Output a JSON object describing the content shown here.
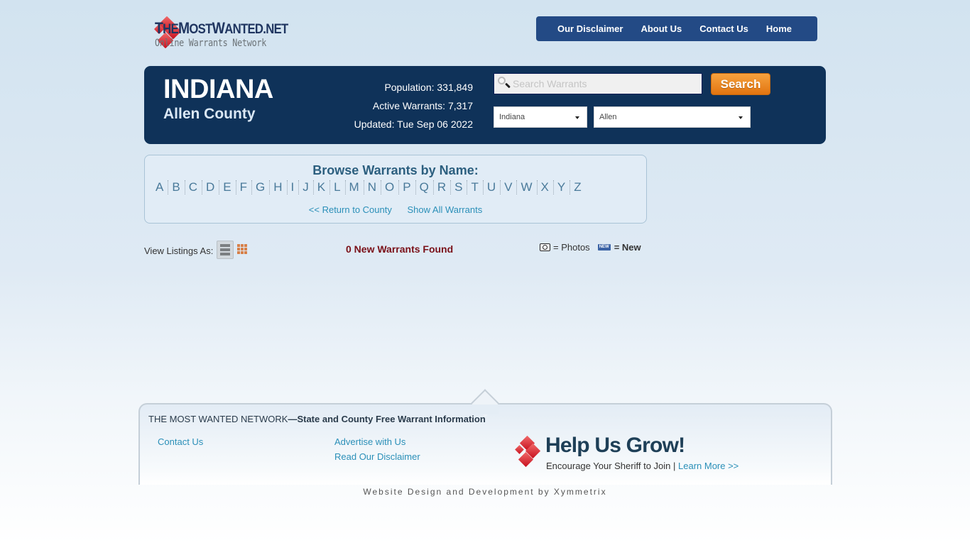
{
  "header": {
    "logo_title_parts": [
      "T",
      "HE",
      "M",
      "OST",
      "W",
      "ANTED.NET"
    ],
    "logo_title": "TheMostWanted.net",
    "logo_subtitle": "Online Warrants Network",
    "nav": [
      {
        "label": "Our Disclaimer"
      },
      {
        "label": "About Us"
      },
      {
        "label": "Contact Us"
      },
      {
        "label": "Home"
      }
    ]
  },
  "banner": {
    "state": "INDIANA",
    "county": "Allen County",
    "population": "Population: 331,849",
    "active_warrants": "Active Warrants: 7,317",
    "updated": "Updated: Tue Sep 06 2022",
    "search": {
      "placeholder": "Search Warrants",
      "value": "",
      "button_label": "Search",
      "button_color": "#e8831e"
    },
    "state_select": {
      "selected": "Indiana"
    },
    "county_select": {
      "selected": "Allen"
    }
  },
  "browse": {
    "heading": "Browse Warrants by Name:",
    "letters": [
      "A",
      "B",
      "C",
      "D",
      "E",
      "F",
      "G",
      "H",
      "I",
      "J",
      "K",
      "L",
      "M",
      "N",
      "O",
      "P",
      "Q",
      "R",
      "S",
      "T",
      "U",
      "V",
      "W",
      "X",
      "Y",
      "Z"
    ],
    "return_link": "<< Return to County",
    "show_all_link": "Show All Warrants"
  },
  "listings": {
    "view_label": "View Listings As:",
    "views": [
      {
        "icon": "list-view-icon",
        "active": true
      },
      {
        "icon": "grid-view-icon",
        "active": false
      }
    ],
    "found_text": "0 New Warrants Found",
    "found_color": "#7a1018",
    "legend": {
      "photos_icon": "camera-icon",
      "photos_label": "= Photos",
      "new_icon": "new-badge-icon",
      "new_badge_text": "NEW",
      "new_label": "= New"
    }
  },
  "footer": {
    "title_bold": "THE MOST WANTED NETWORK",
    "title_rest": "—State and County Free Warrant Information",
    "links": [
      {
        "label": "Contact Us"
      },
      {
        "label": "Advertise with Us"
      },
      {
        "label": "Read Our Disclaimer"
      }
    ],
    "help_title": "Help Us Grow!",
    "help_text": "Encourage Your Sheriff to Join | ",
    "help_link": "Learn More >>",
    "credit": "Website Design and Development by Xymmetrix"
  },
  "colors": {
    "nav_bg": "#234a85",
    "banner_bg": "#0f3259",
    "link": "#2a8fb8",
    "brand_red": "#c8101e"
  }
}
